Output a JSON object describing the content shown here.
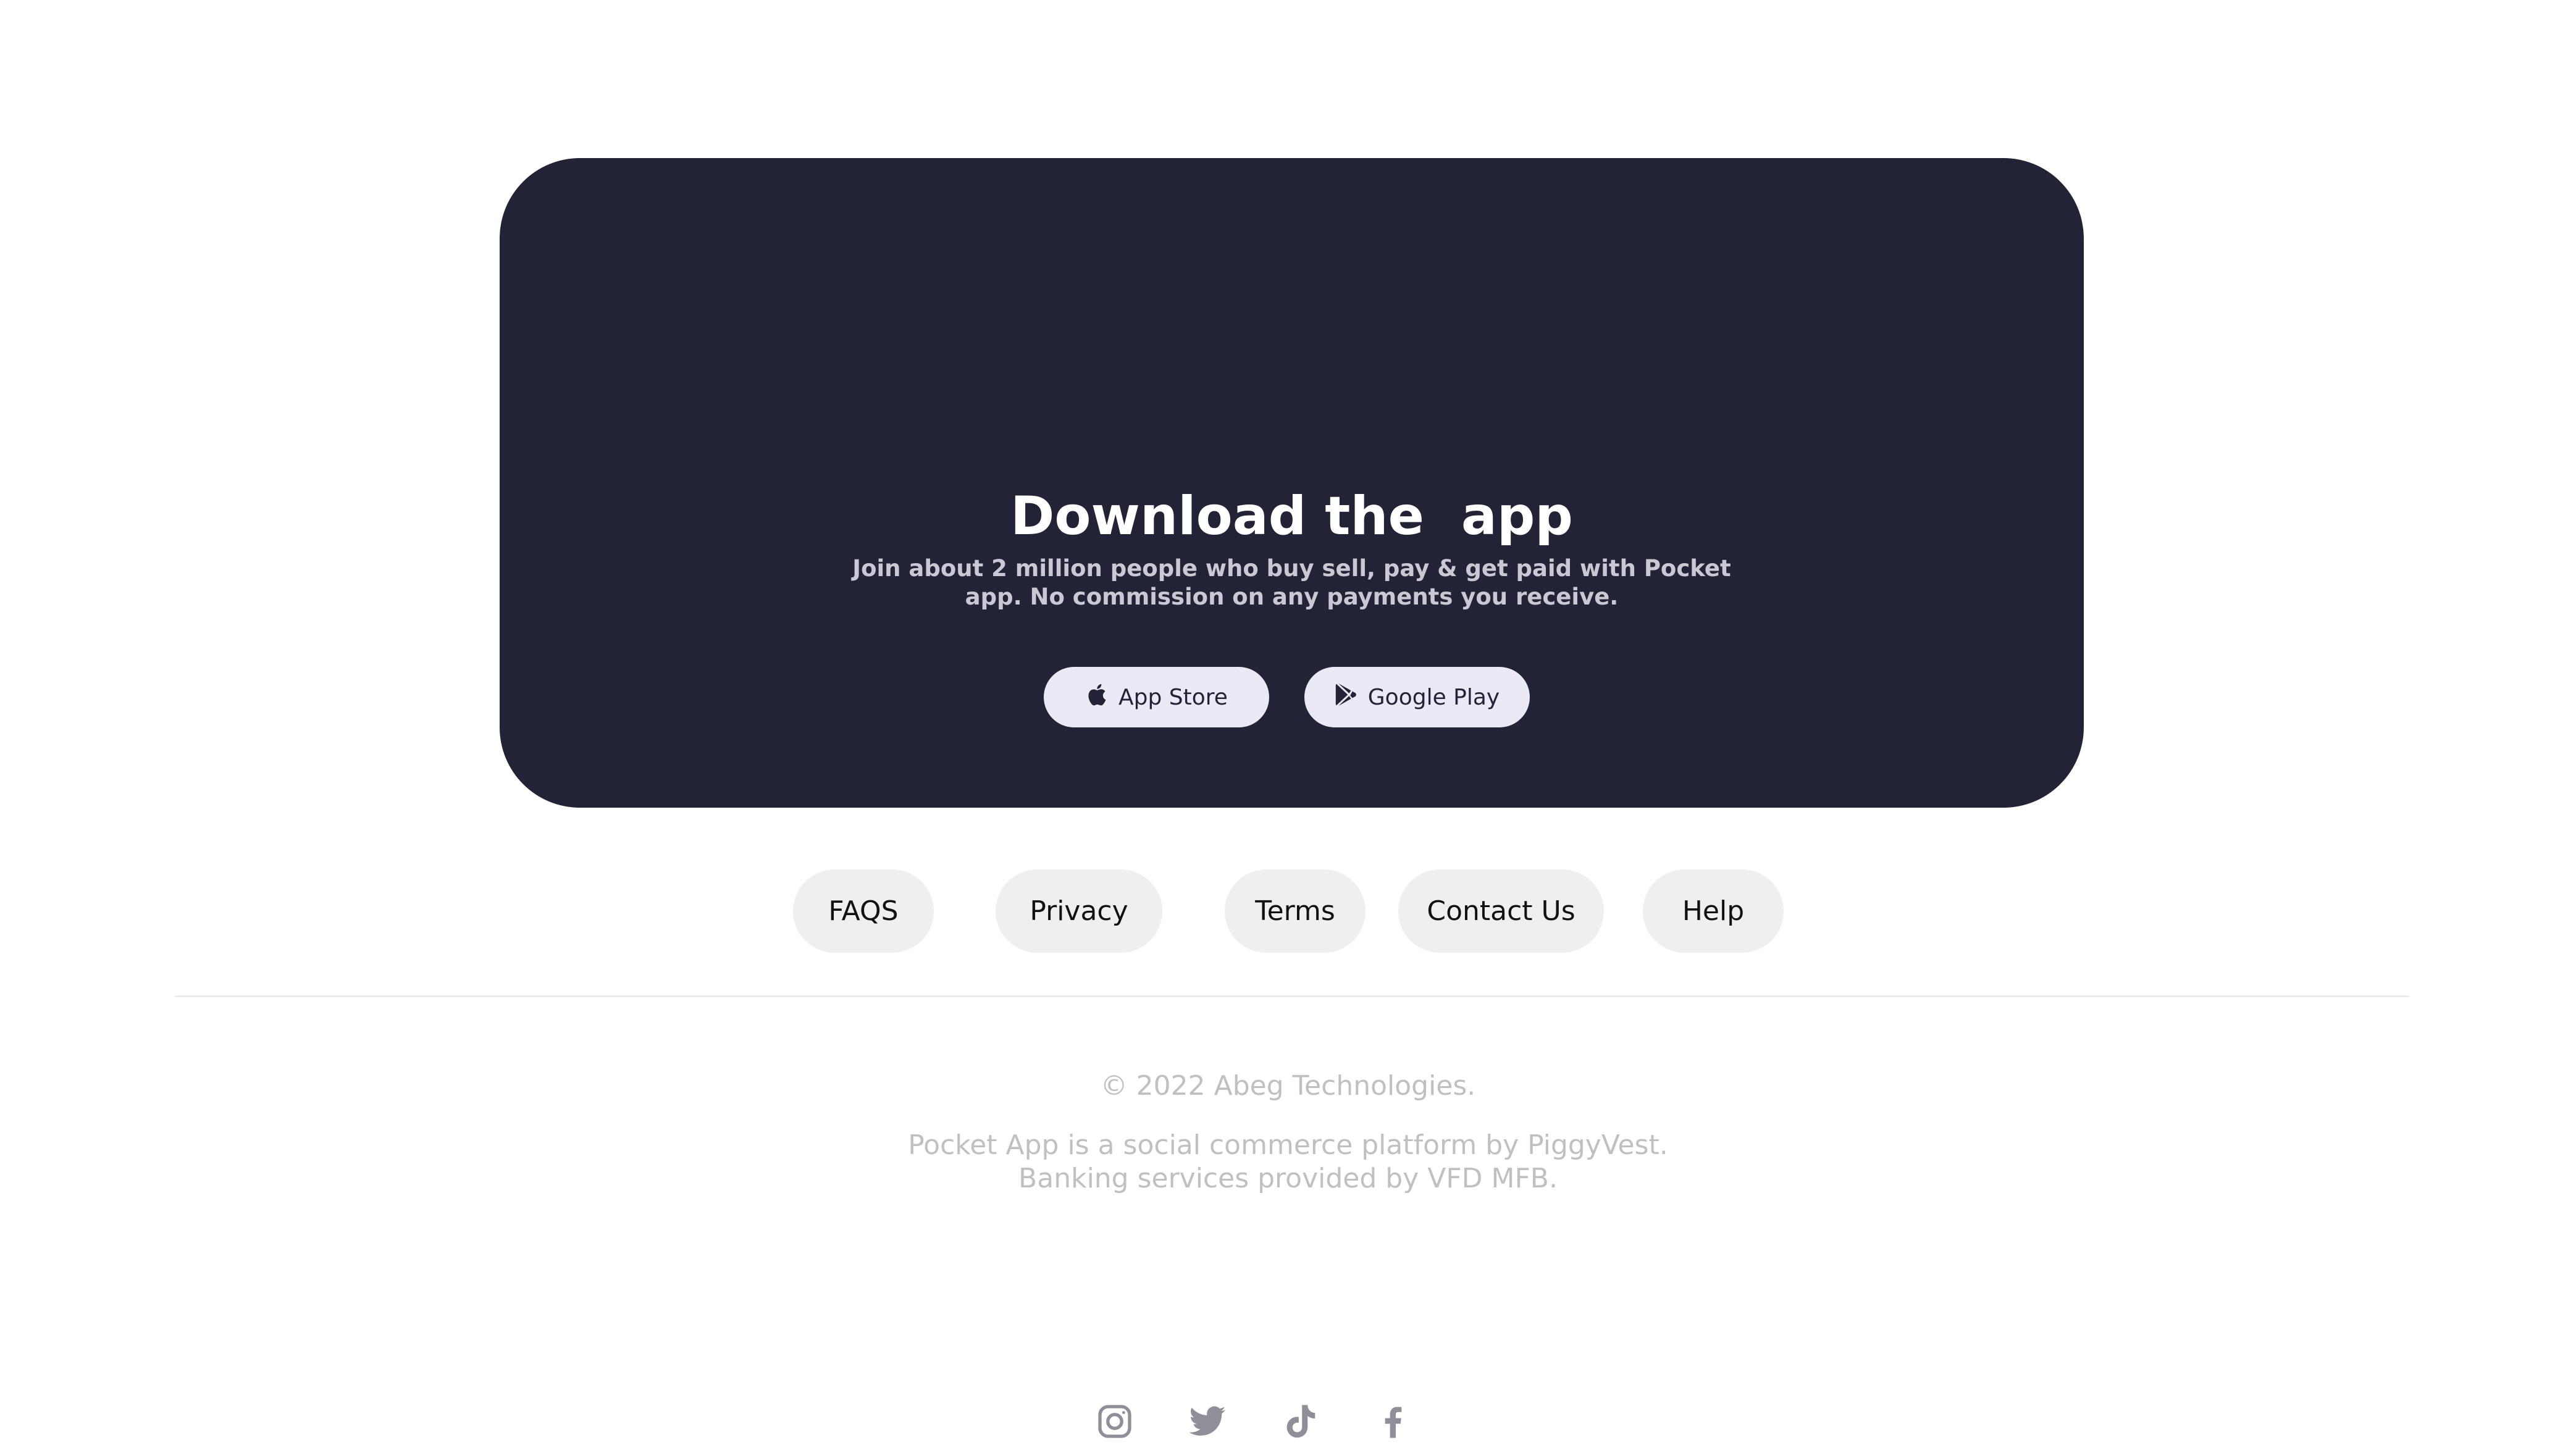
{
  "hero": {
    "title": "Download the  app",
    "subtitle_line1": "Join about 2 million people who buy sell, pay & get paid with Pocket",
    "subtitle_line2": "app. No commission on any payments you receive.",
    "buttons": [
      {
        "label": "App Store",
        "icon": "apple-icon"
      },
      {
        "label": "Google Play",
        "icon": "google-play-icon"
      }
    ]
  },
  "footer": {
    "links": [
      "FAQS",
      "Privacy",
      "Terms",
      "Contact Us",
      "Help"
    ],
    "copyright": "© 2022 Abeg Technologies.",
    "about_line1": "Pocket App is a social commerce platform by PiggyVest.",
    "about_line2": "Banking services provided by VFD MFB.",
    "social": [
      "instagram-icon",
      "twitter-icon",
      "tiktok-icon",
      "facebook-icon"
    ]
  },
  "colors": {
    "hero_bg": "#222336",
    "button_bg": "#ece9f6",
    "pill_bg": "#efefef",
    "muted_text": "#c0c0c0",
    "icon_gray": "#8f8f99"
  }
}
